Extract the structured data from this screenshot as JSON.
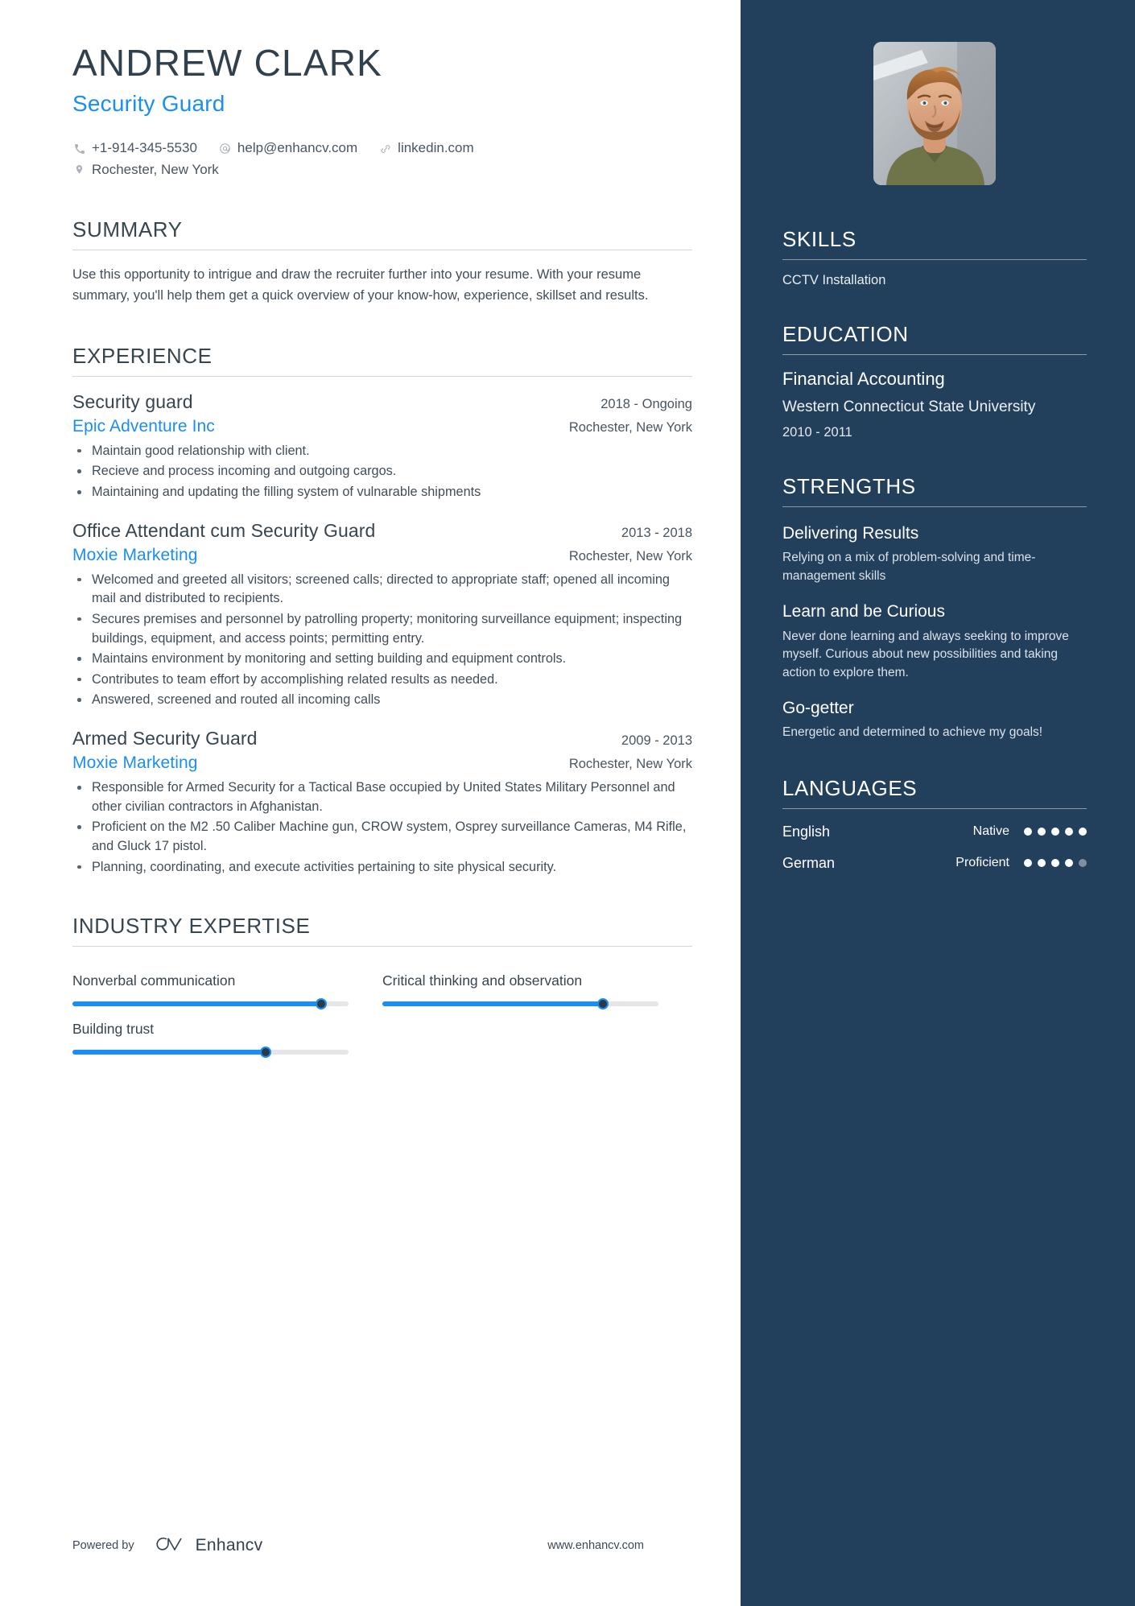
{
  "theme": {
    "accent": "#1b8ef2",
    "sidebar_bg": "#223f5c",
    "heading": "#37454f",
    "body_text": "#414d58"
  },
  "header": {
    "name": "ANDREW CLARK",
    "job_title": "Security Guard",
    "contacts": [
      {
        "icon": "phone-icon",
        "text": "+1-914-345-5530"
      },
      {
        "icon": "email-icon",
        "text": "help@enhancv.com"
      },
      {
        "icon": "link-icon",
        "text": "linkedin.com"
      }
    ],
    "location": {
      "icon": "location-pin-icon",
      "text": "Rochester, New York"
    }
  },
  "summary": {
    "title": "SUMMARY",
    "text": "Use this opportunity to intrigue and draw the recruiter further into your resume. With your resume summary, you'll help them get a quick overview of your know-how, experience, skillset and results."
  },
  "experience": {
    "title": "EXPERIENCE",
    "items": [
      {
        "role": "Security guard",
        "date": "2018 - Ongoing",
        "company": "Epic Adventure Inc",
        "location": "Rochester, New York",
        "bullets": [
          "Maintain good relationship with client.",
          "Recieve and process incoming and outgoing cargos.",
          "Maintaining and updating the filling system of vulnarable shipments"
        ]
      },
      {
        "role": "Office Attendant cum Security Guard",
        "date": "2013 - 2018",
        "company": "Moxie Marketing",
        "location": "Rochester, New York",
        "bullets": [
          "Welcomed and greeted all visitors; screened calls; directed to appropriate staff; opened all incoming mail and distributed to recipients.",
          "Secures premises and personnel by patrolling property; monitoring surveillance equipment; inspecting buildings, equipment, and access points; permitting entry.",
          "Maintains environment by monitoring and setting building and equipment controls.",
          "Contributes to team effort by accomplishing related results as needed.",
          "Answered, screened and routed all incoming calls"
        ]
      },
      {
        "role": "Armed Security Guard",
        "date": "2009 - 2013",
        "company": "Moxie Marketing",
        "location": "Rochester, New York",
        "bullets": [
          "Responsible for Armed Security for a Tactical Base occupied by United States Military Personnel and other civilian contractors in Afghanistan.",
          "Proficient on the M2 .50 Caliber  Machine gun, CROW  system, Osprey surveillance Cameras, M4 Rifle, and Gluck 17 pistol.",
          "Planning, coordinating, and execute activities pertaining to site physical security."
        ]
      }
    ]
  },
  "industry_expertise": {
    "title": "INDUSTRY EXPERTISE",
    "items": [
      {
        "label": "Nonverbal communication",
        "value": 90
      },
      {
        "label": "Critical thinking and observation",
        "value": 80
      },
      {
        "label": "Building trust",
        "value": 70
      }
    ]
  },
  "skills": {
    "title": "SKILLS",
    "items": [
      "CCTV Installation"
    ]
  },
  "education": {
    "title": "EDUCATION",
    "items": [
      {
        "degree": "Financial Accounting",
        "school": "Western Connecticut State University",
        "date": "2010 - 2011"
      }
    ]
  },
  "strengths": {
    "title": "STRENGTHS",
    "items": [
      {
        "name": "Delivering Results",
        "description": "Relying on a mix of problem-solving and time-management skills"
      },
      {
        "name": "Learn and be Curious",
        "description": "Never done learning and always seeking to improve myself. Curious about new possibilities and taking action to explore them."
      },
      {
        "name": "Go-getter",
        "description": "Energetic and determined to achieve my goals!"
      }
    ]
  },
  "languages": {
    "title": "LANGUAGES",
    "items": [
      {
        "name": "English",
        "level": "Native",
        "filled": 5,
        "total": 5
      },
      {
        "name": "German",
        "level": "Proficient",
        "filled": 4,
        "total": 5
      }
    ]
  },
  "footer": {
    "powered_by": "Powered by",
    "brand": "Enhancv",
    "url": "www.enhancv.com"
  }
}
